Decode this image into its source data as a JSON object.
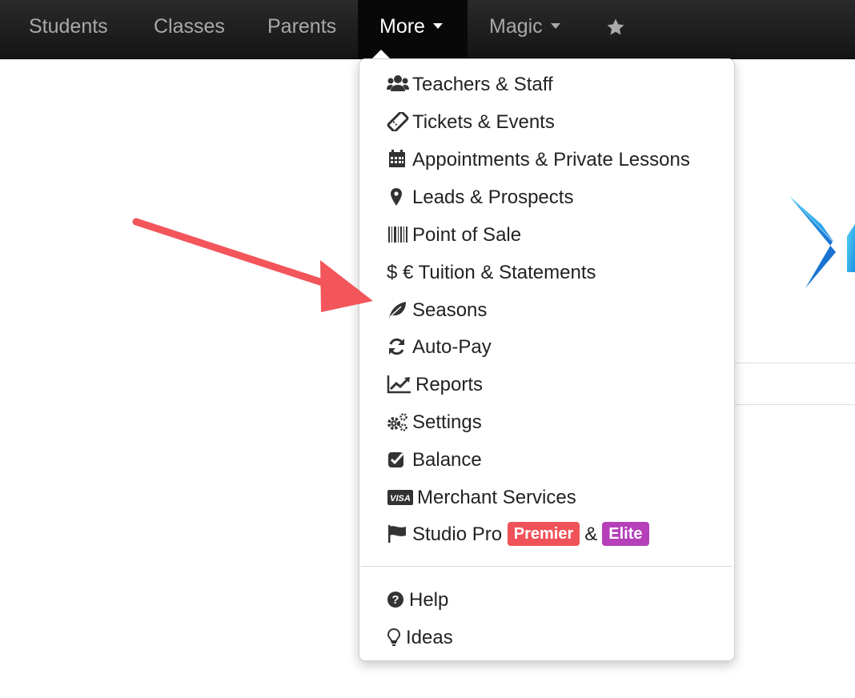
{
  "navbar": {
    "items": [
      {
        "label": "Students"
      },
      {
        "label": "Classes"
      },
      {
        "label": "Parents"
      },
      {
        "label": "More"
      },
      {
        "label": "Magic"
      }
    ],
    "star_icon": "star-icon"
  },
  "dropdown": {
    "items": [
      {
        "label": "Teachers & Staff",
        "icon": "users-icon"
      },
      {
        "label": "Tickets & Events",
        "icon": "ticket-icon"
      },
      {
        "label": "Appointments & Private Lessons",
        "icon": "calendar-icon"
      },
      {
        "label": "Leads & Prospects",
        "icon": "map-marker-icon"
      },
      {
        "label": "Point of Sale",
        "icon": "barcode-icon"
      },
      {
        "label": "$ € Tuition & Statements",
        "icon": "currency-icon"
      },
      {
        "label": "Seasons",
        "icon": "leaf-icon"
      },
      {
        "label": "Auto-Pay",
        "icon": "refresh-icon"
      },
      {
        "label": "Reports",
        "icon": "line-chart-icon"
      },
      {
        "label": "Settings",
        "icon": "cogs-icon"
      },
      {
        "label": "Balance",
        "icon": "check-square-icon"
      },
      {
        "label": "Merchant Services",
        "icon": "visa-card-icon"
      },
      {
        "label": "Studio Pro",
        "icon": "flag-icon",
        "badge1": "Premier",
        "joiner": "&",
        "badge2": "Elite"
      }
    ],
    "footer_items": [
      {
        "label": "Help",
        "icon": "question-circle-icon"
      },
      {
        "label": "Ideas",
        "icon": "lightbulb-icon"
      }
    ]
  },
  "colors": {
    "navbar_bg": "#1b1b1b",
    "premier_badge": "#f0525a",
    "elite_badge": "#b540b9",
    "annotation_arrow": "#f2555a"
  }
}
